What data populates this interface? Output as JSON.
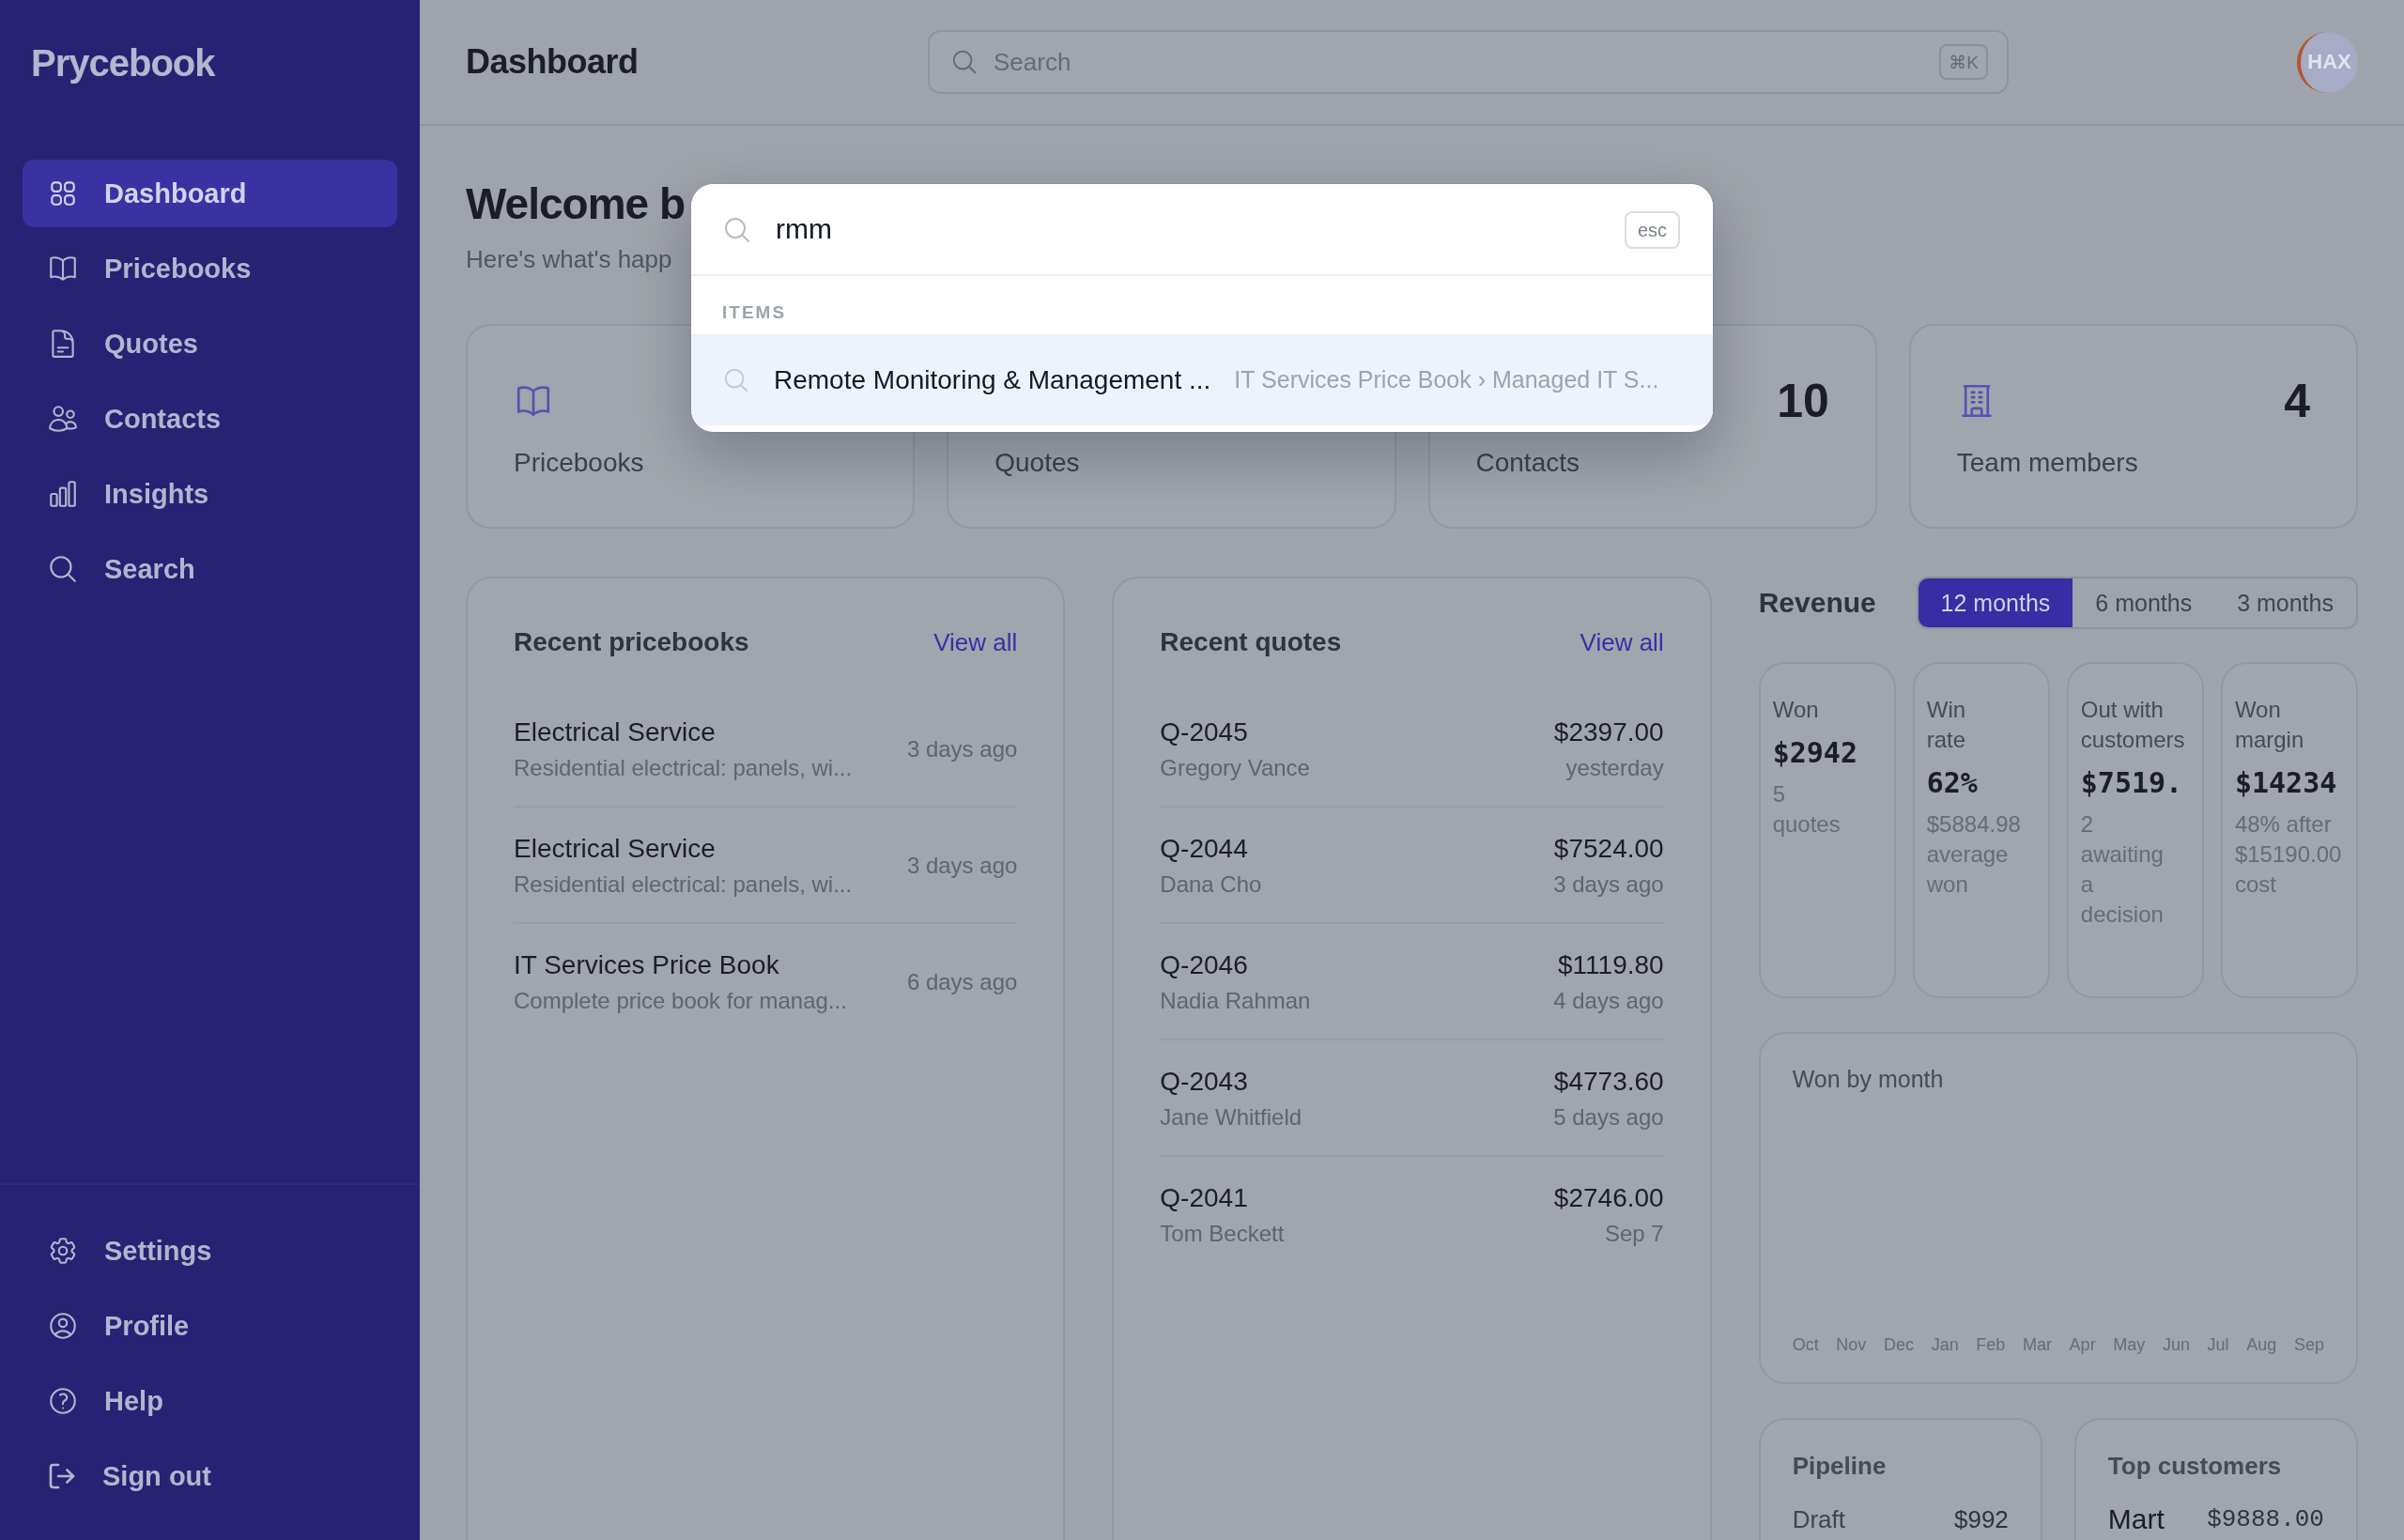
{
  "sidebar": {
    "logo": "Prycebook",
    "nav": [
      {
        "label": "Dashboard",
        "selected": true
      },
      {
        "label": "Pricebooks",
        "selected": false
      },
      {
        "label": "Quotes",
        "selected": false
      },
      {
        "label": "Contacts",
        "selected": false
      },
      {
        "label": "Insights",
        "selected": false
      },
      {
        "label": "Search",
        "selected": false
      }
    ],
    "footer_nav": [
      {
        "label": "Settings",
        "selected": false
      },
      {
        "label": "Profile",
        "selected": false
      },
      {
        "label": "Help",
        "selected": false
      },
      {
        "label": "Sign out",
        "selected": false
      }
    ]
  },
  "header": {
    "title": "Dashboard",
    "search": {
      "placeholder": "Search",
      "shortcut": "⌘K"
    },
    "avatar": {
      "initials": "HAX"
    }
  },
  "welcome": {
    "title": "Welcome b",
    "subtitle": "Here's what's happ"
  },
  "stat_cards": [
    {
      "label": "Pricebooks"
    },
    {
      "label": "Quotes"
    },
    {
      "label": "Contacts",
      "value": "10"
    },
    {
      "label": "Team members",
      "value": "4"
    }
  ],
  "recent_pricebooks": {
    "title": "Recent pricebooks",
    "link": "View all",
    "rows": [
      {
        "name": "Electrical Service",
        "description": "Residential electrical: panels, wi...",
        "time": "3 days ago"
      },
      {
        "name": "Electrical Service",
        "description": "Residential electrical: panels, wi...",
        "time": "3 days ago"
      },
      {
        "name": "IT Services Price Book",
        "description": "Complete price book for manag...",
        "time": "6 days ago"
      }
    ]
  },
  "recent_quotes": {
    "title": "Recent quotes",
    "link": "View all",
    "rows": [
      {
        "number": "Q-2045",
        "customer": "Gregory Vance",
        "amount": "$2397.00",
        "time": "yesterday"
      },
      {
        "number": "Q-2044",
        "customer": "Dana Cho",
        "amount": "$7524.00",
        "time": "3 days ago"
      },
      {
        "number": "Q-2046",
        "customer": "Nadia Rahman",
        "amount": "$1119.80",
        "time": "4 days ago"
      },
      {
        "number": "Q-2043",
        "customer": "Jane Whitfield",
        "amount": "$4773.60",
        "time": "5 days ago"
      },
      {
        "number": "Q-2041",
        "customer": "Tom Beckett",
        "amount": "$2746.00",
        "time": "Sep 7"
      }
    ]
  },
  "revenue": {
    "title": "Revenue",
    "ranges": [
      {
        "label": "12 months",
        "selected": true
      },
      {
        "label": "6 months",
        "selected": false
      },
      {
        "label": "3 months",
        "selected": false
      }
    ],
    "metrics": [
      {
        "label": "Won",
        "value": "$2942",
        "note": "5 quotes"
      },
      {
        "label": "Win rate",
        "value": "62%",
        "note": "$5884.98 average won"
      },
      {
        "label": "Out with customers",
        "value": "$7519.",
        "note": "2 awaiting a decision"
      },
      {
        "label": "Won margin",
        "value": "$14234",
        "note": "48% after $15190.00 cost"
      }
    ]
  },
  "won_by_month": {
    "title": "Won by month",
    "months": [
      "Oct",
      "Nov",
      "Dec",
      "Jan",
      "Feb",
      "Mar",
      "Apr",
      "May",
      "Jun",
      "Jul",
      "Aug",
      "Sep"
    ]
  },
  "pipeline": {
    "title": "Pipeline",
    "rows": [
      {
        "stage": "Draft",
        "amount": "$992"
      }
    ]
  },
  "top_customers": {
    "title": "Top customers",
    "rows": [
      {
        "name": "Mart",
        "amount": "$9888.00"
      }
    ]
  },
  "search_dialog": {
    "query": "rmm",
    "close_hint": "esc",
    "section": "ITEMS",
    "results": [
      {
        "title": "Remote Monitoring & Management ...",
        "path": "IT Services Price Book › Managed IT S...",
        "selected": true
      }
    ]
  }
}
